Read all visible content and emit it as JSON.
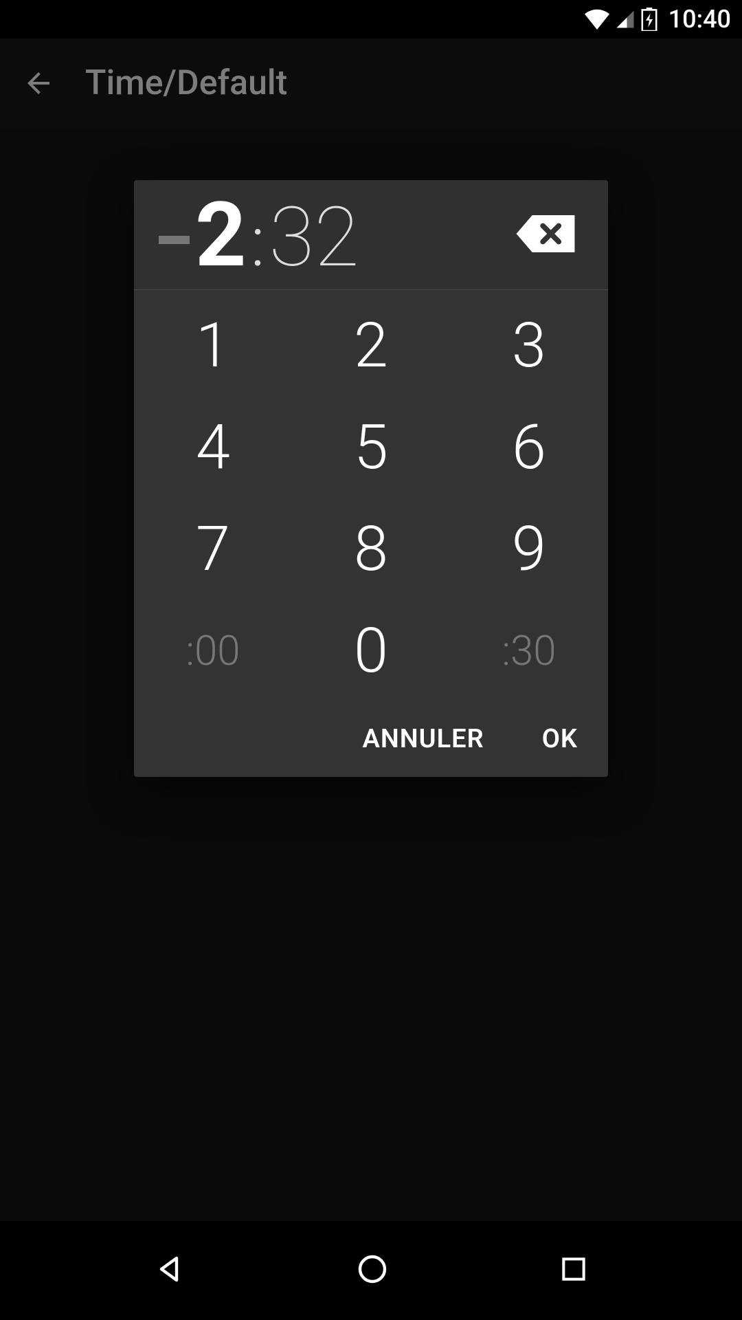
{
  "status": {
    "time": "10:40"
  },
  "app": {
    "title": "Time/Default"
  },
  "dialog": {
    "time_display": {
      "hour_last": "2",
      "minutes": "32"
    },
    "keypad": {
      "k1": "1",
      "k2": "2",
      "k3": "3",
      "k4": "4",
      "k5": "5",
      "k6": "6",
      "k7": "7",
      "k8": "8",
      "k9": "9",
      "k00": ":00",
      "k0": "0",
      "k30": ":30"
    },
    "actions": {
      "cancel": "ANNULER",
      "ok": "OK"
    }
  }
}
